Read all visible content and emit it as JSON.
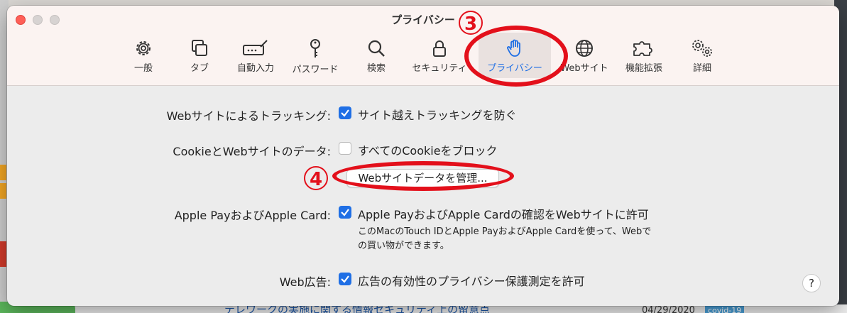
{
  "window": {
    "title": "プライバシー"
  },
  "tabs": [
    {
      "label": "一般",
      "icon": "gear-icon"
    },
    {
      "label": "タブ",
      "icon": "tabs-icon"
    },
    {
      "label": "自動入力",
      "icon": "autofill-icon"
    },
    {
      "label": "パスワード",
      "icon": "key-icon"
    },
    {
      "label": "検索",
      "icon": "search-icon"
    },
    {
      "label": "セキュリティ",
      "icon": "lock-icon"
    },
    {
      "label": "プライバシー",
      "icon": "hand-icon",
      "selected": true
    },
    {
      "label": "Webサイト",
      "icon": "globe-icon"
    },
    {
      "label": "機能拡張",
      "icon": "puzzle-icon"
    },
    {
      "label": "詳細",
      "icon": "gears-icon"
    }
  ],
  "settings": {
    "tracking": {
      "label": "Webサイトによるトラッキング:",
      "option": "サイト越えトラッキングを防ぐ",
      "checked": true
    },
    "cookies": {
      "label": "CookieとWebサイトのデータ:",
      "option": "すべてのCookieをブロック",
      "checked": false,
      "button": "Webサイトデータを管理..."
    },
    "apple_pay": {
      "label": "Apple PayおよびApple Card:",
      "option": "Apple PayおよびApple Cardの確認をWebサイトに許可",
      "checked": true,
      "note_line1": "このMacのTouch IDとApple PayおよびApple Cardを使って、Webで",
      "note_line2": "の買い物ができます。"
    },
    "web_ads": {
      "label": "Web広告:",
      "option": "広告の有効性のプライバシー保護測定を許可",
      "checked": true
    },
    "help": "?"
  },
  "annotations": {
    "step3": "3",
    "step4": "4"
  },
  "background": {
    "bottom_text": "テレワークの実施に関する情報セキュリティ上の留意点",
    "bottom_date": "04/29/2020",
    "bottom_badge": "covid-19"
  },
  "colors": {
    "accent": "#1f6fe5",
    "annotation": "#e3101b",
    "close": "#fe5f57"
  }
}
